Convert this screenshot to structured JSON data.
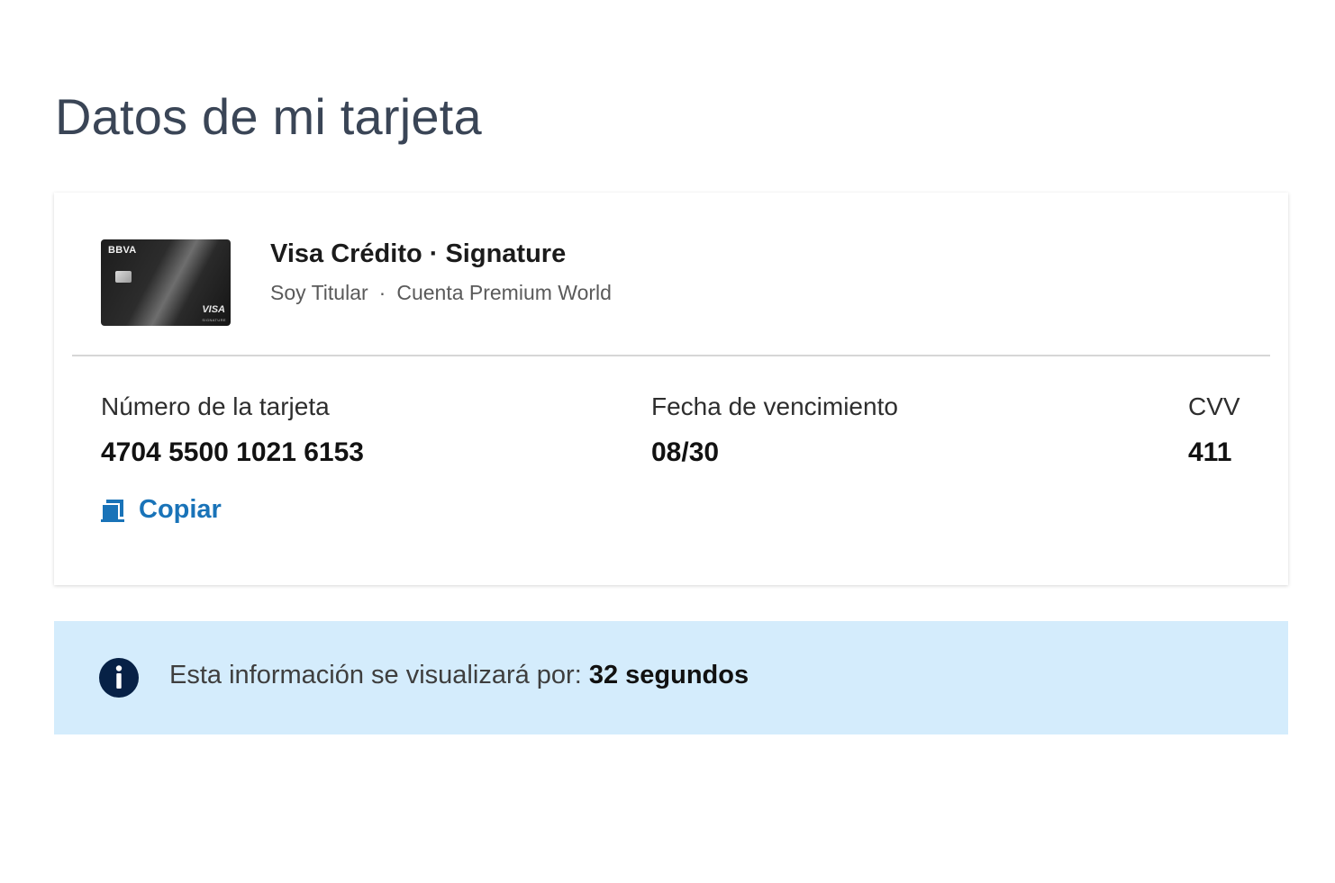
{
  "page": {
    "title": "Datos de mi tarjeta"
  },
  "card": {
    "image": {
      "brand": "BBVA",
      "network": "VISA",
      "tier": "SIGNATURE"
    },
    "product_name": "Visa Crédito · Signature",
    "holder_role": "Soy Titular",
    "separator": "·",
    "account_name": "Cuenta Premium World",
    "number_label": "Número de la tarjeta",
    "number_value": "4704 5500 1021 6153",
    "expiry_label": "Fecha de vencimiento",
    "expiry_value": "08/30",
    "cvv_label": "CVV",
    "cvv_value": "411",
    "copy_label": "Copiar",
    "copy_icon": "copy-icon"
  },
  "notice": {
    "icon": "info-icon",
    "text": "Esta información se visualizará por:",
    "countdown": "32 segundos"
  },
  "colors": {
    "accent": "#1973b8",
    "notice_background": "#d4ecfc",
    "info_icon": "#072146",
    "title": "#3a4556"
  }
}
